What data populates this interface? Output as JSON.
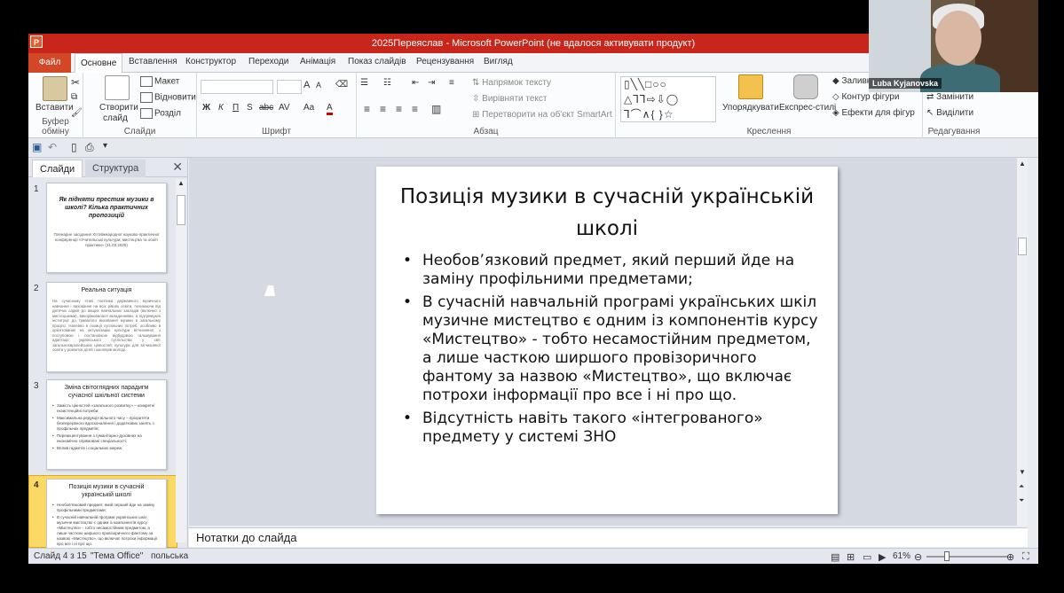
{
  "window": {
    "title": "2025Переяслав  -  Microsoft PowerPoint (не вдалося активувати продукт)",
    "app_icon": "P"
  },
  "tabs": [
    "Файл",
    "Основне",
    "Вставлення",
    "Конструктор",
    "Переходи",
    "Анімація",
    "Показ слайдів",
    "Рецензування",
    "Вигляд"
  ],
  "ribbon": {
    "clipboard": {
      "paste": "Вставити",
      "label": "Буфер обміну"
    },
    "slides": {
      "new_slide_1": "Створити",
      "new_slide_2": "слайд",
      "layout": "Макет",
      "reset": "Відновити",
      "section": "Розділ",
      "label": "Слайди"
    },
    "font": {
      "bold": "Ж",
      "italic": "К",
      "underline": "П",
      "shadow": "S",
      "strike": "abc",
      "spacing": "AV",
      "case": "Aa",
      "color": "A",
      "grow": "A",
      "shrink": "A",
      "label": "Шрифт"
    },
    "paragraph": {
      "text_direction": "Напрямок тексту",
      "align_text": "Вирівняти текст",
      "smartart": "Перетворити на об'єкт SmartArt",
      "label": "Абзац"
    },
    "drawing": {
      "arrange": "Упорядкувати",
      "quick_styles": "Експрес-стилі",
      "fill": "Заливка",
      "outline": "Контур фігури",
      "effects": "Ефекти для фігур",
      "label": "Креслення"
    },
    "editing": {
      "replace": "Замінити",
      "select": "Виділити",
      "label": "Редагування"
    }
  },
  "panel": {
    "tab_slides": "Слайди",
    "tab_outline": "Структура",
    "close": "✕"
  },
  "thumbnails": [
    {
      "num": "1",
      "title": "Як підняти престиж музики в школі? Кілька практичних пропозицій",
      "body": "Пленарне засідання XII Міжнародної науково-практичної конференції «Учительські культури; мистецтва та освіті практики» (31.03.2025)"
    },
    {
      "num": "2",
      "title": "Реальна ситуація",
      "body": "На сучасному етапі політика державного музичного навчання і виховання на всіх рівнях освіти, починаючи від дитячих садків до вищих навчальних закладів (включно з мистецькими), викорінювалася вкладеннями, а підтримуючі інституції до тривалого виховання музики в загальному процесі. Напевно в позиції суспільних потреб, особливо в орієнтованих на актуалізацію культури вітчизняної, з поступовою і постановкою відбудовою гальмування адаптації українського суспільства у світ загальноєвропейських цінностей; культури для вітчизняної освіти у розвиток дітей і школярів молоді."
    },
    {
      "num": "3",
      "title": "Зміна світоглядних парадигм сучасної шкільної системи",
      "items": [
        "Замість цінностей «загального розвитку» – конкретні екзистенційні потреби;",
        "Максимальна редукція вільного часу – пріоритети безперервного вдосконалення і додаткових занять з профільних предметів;",
        "Переакцентування з гуманітарно-духовних на економічно спрямовані спеціальності;",
        "Вплив гаджетів і соціальних мереж."
      ]
    },
    {
      "num": "4",
      "title": "Позиція музики в сучасній українській школі",
      "items": [
        "Необов'язковий предмет, який перший йде на заміну профільними предметами;",
        "В сучасній навчальній програмі українських шкіл музичне мистецтво є одним із компонентів курсу «Мистецтво» - тобто несамостійним предметом, а лише часткою ширшого провізоричного фантому за назвою «Мистецтво», що включає потрохи інформації про все і ні про що."
      ]
    }
  ],
  "slide": {
    "title": "Позиція музики в сучасній українській школі",
    "bullets": [
      "Необов’язковий предмет, який перший йде на заміну профільними предметами;",
      "В сучасній навчальній програмі українських шкіл музичне мистецтво є одним із компонентів курсу «Мистецтво» - тобто несамостійним предметом, а лише часткою ширшого провізоричного фантому за назвою «Мистецтво», що включає потрохи інформації про все і ні про що.",
      "Відсутність навіть такого «інтегрованого» предмету у системі ЗНО"
    ]
  },
  "notes": {
    "placeholder": "Нотатки до слайда"
  },
  "status": {
    "slide": "Слайд 4 з 15",
    "theme": "\"Тема Office\"",
    "language": "польська",
    "zoom": "61%",
    "zoom_fraction": 0.61
  },
  "webcam": {
    "name": "Luba Kyjanovska"
  },
  "colors": {
    "titlebar": "#c8261b",
    "file_tab": "#d24726",
    "selected_thumb": "#fbd964"
  }
}
